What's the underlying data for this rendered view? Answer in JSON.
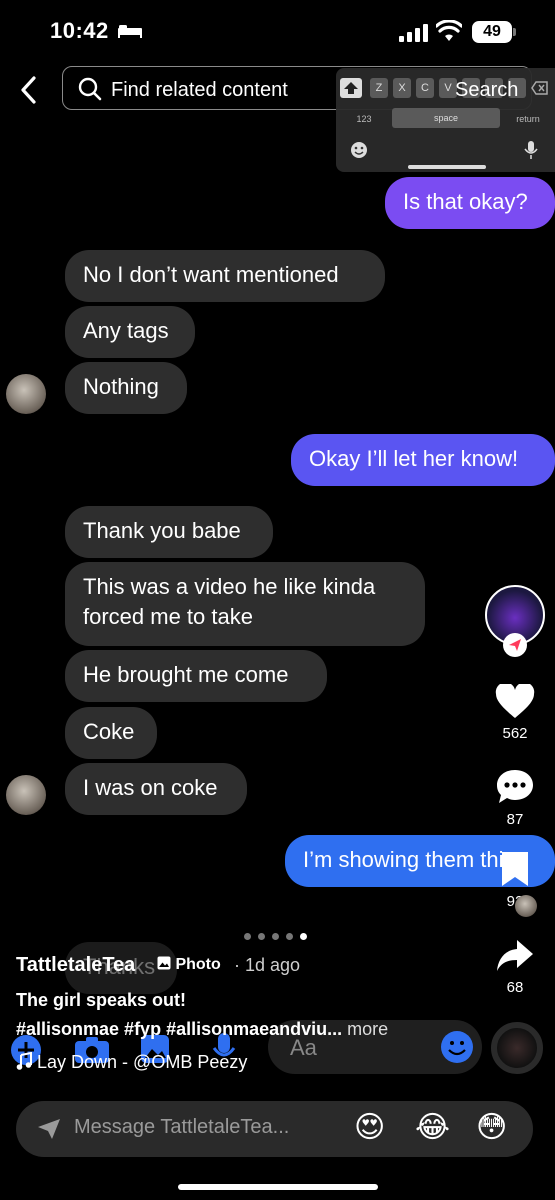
{
  "status": {
    "time": "10:42",
    "battery": "49"
  },
  "search": {
    "placeholder": "Find related content",
    "button_label": "Search"
  },
  "keyboard": {
    "keys_top": [
      "Z",
      "X",
      "C",
      "V"
    ],
    "key_123": "123",
    "key_space": "space",
    "key_return": "return"
  },
  "messages": [
    {
      "side": "out",
      "text": "Is that okay?"
    },
    {
      "side": "in",
      "text": "No I don’t want mentioned"
    },
    {
      "side": "in",
      "text": "Any tags"
    },
    {
      "side": "in",
      "text": "Nothing"
    },
    {
      "side": "out",
      "text": "Okay I’ll let her know!"
    },
    {
      "side": "in",
      "text": "Thank you babe"
    },
    {
      "side": "in",
      "text": "This was a video he like kinda forced me to take"
    },
    {
      "side": "in",
      "text": "He brought me come"
    },
    {
      "side": "in",
      "text": "Coke"
    },
    {
      "side": "in",
      "text": "I was on coke"
    },
    {
      "side": "out",
      "text": "I’m showing them this"
    },
    {
      "side": "in",
      "text": "Thanks"
    }
  ],
  "chat_input_placeholder": "Aa",
  "rail": {
    "likes": "562",
    "comments": "87",
    "saves": "92",
    "shares": "68"
  },
  "post": {
    "author": "TattletaleTea",
    "type_label": "Photo",
    "time_ago": "· 1d ago",
    "caption": "The girl speaks out!",
    "hashtags": "#allisonmae #fyp #allisonmaeandviu...",
    "more_label": "more",
    "music": "Lay Down - @OMB Peezy",
    "slide_count": 5,
    "active_slide": 5
  },
  "message_bar": {
    "placeholder": "Message TattletaleTea...",
    "emojis": [
      "😍",
      "😂",
      "😳"
    ]
  },
  "colors": {
    "out_purple": "#7b4cf2",
    "out_violet": "#5a55f2",
    "out_blue": "#2f6ff0",
    "in_bubble": "#2e2e2e"
  },
  "icons": [
    "bed-icon",
    "signal-icon",
    "wifi-icon",
    "battery-icon",
    "back-icon",
    "search-icon",
    "heart-icon",
    "comment-icon",
    "bookmark-icon",
    "share-icon",
    "send-icon",
    "music-icon",
    "photo-icon"
  ]
}
